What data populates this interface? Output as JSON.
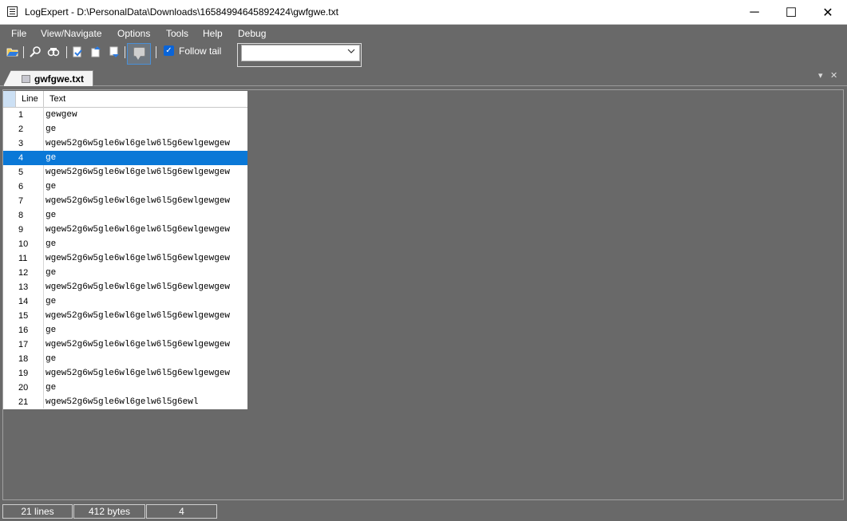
{
  "window": {
    "title": "LogExpert - D:\\PersonalData\\Downloads\\16584994645892424\\gwfgwe.txt",
    "minimize_glyph": "─",
    "maximize_glyph": "☐",
    "close_glyph": "✕"
  },
  "menu": {
    "items": [
      "File",
      "View/Navigate",
      "Options",
      "Tools",
      "Help",
      "Debug"
    ]
  },
  "toolbar": {
    "icons": [
      "open-file-icon",
      "search-icon",
      "filter-icon",
      "refresh-icon",
      "bookmark-up-icon",
      "bookmark-down-icon",
      "bubble-icon"
    ],
    "follow_tail_label": "Follow tail",
    "follow_tail_checked": true,
    "combo_value": ""
  },
  "tabs": [
    {
      "label": "gwfgwe.txt",
      "active": true
    }
  ],
  "grid": {
    "columns": [
      "Line",
      "Text"
    ],
    "selected_line": 4,
    "rows": [
      {
        "line": "1",
        "text": "gewgew"
      },
      {
        "line": "2",
        "text": "ge"
      },
      {
        "line": "3",
        "text": "wgew52g6w5gle6wl6gelw6l5g6ewlgewgew"
      },
      {
        "line": "4",
        "text": "ge"
      },
      {
        "line": "5",
        "text": "wgew52g6w5gle6wl6gelw6l5g6ewlgewgew"
      },
      {
        "line": "6",
        "text": "ge"
      },
      {
        "line": "7",
        "text": "wgew52g6w5gle6wl6gelw6l5g6ewlgewgew"
      },
      {
        "line": "8",
        "text": "ge"
      },
      {
        "line": "9",
        "text": "wgew52g6w5gle6wl6gelw6l5g6ewlgewgew"
      },
      {
        "line": "10",
        "text": "ge"
      },
      {
        "line": "11",
        "text": "wgew52g6w5gle6wl6gelw6l5g6ewlgewgew"
      },
      {
        "line": "12",
        "text": "ge"
      },
      {
        "line": "13",
        "text": "wgew52g6w5gle6wl6gelw6l5g6ewlgewgew"
      },
      {
        "line": "14",
        "text": "ge"
      },
      {
        "line": "15",
        "text": "wgew52g6w5gle6wl6gelw6l5g6ewlgewgew"
      },
      {
        "line": "16",
        "text": "ge"
      },
      {
        "line": "17",
        "text": "wgew52g6w5gle6wl6gelw6l5g6ewlgewgew"
      },
      {
        "line": "18",
        "text": "ge"
      },
      {
        "line": "19",
        "text": "wgew52g6w5gle6wl6gelw6l5g6ewlgewgew"
      },
      {
        "line": "20",
        "text": "ge"
      },
      {
        "line": "21",
        "text": "wgew52g6w5gle6wl6gelw6l5g6ewl"
      }
    ]
  },
  "status": {
    "lines": "21 lines",
    "bytes": "412 bytes",
    "current_line": "4"
  },
  "colors": {
    "background": "#696969",
    "selection": "#0a78d7",
    "checkbox": "#0a64d8"
  }
}
